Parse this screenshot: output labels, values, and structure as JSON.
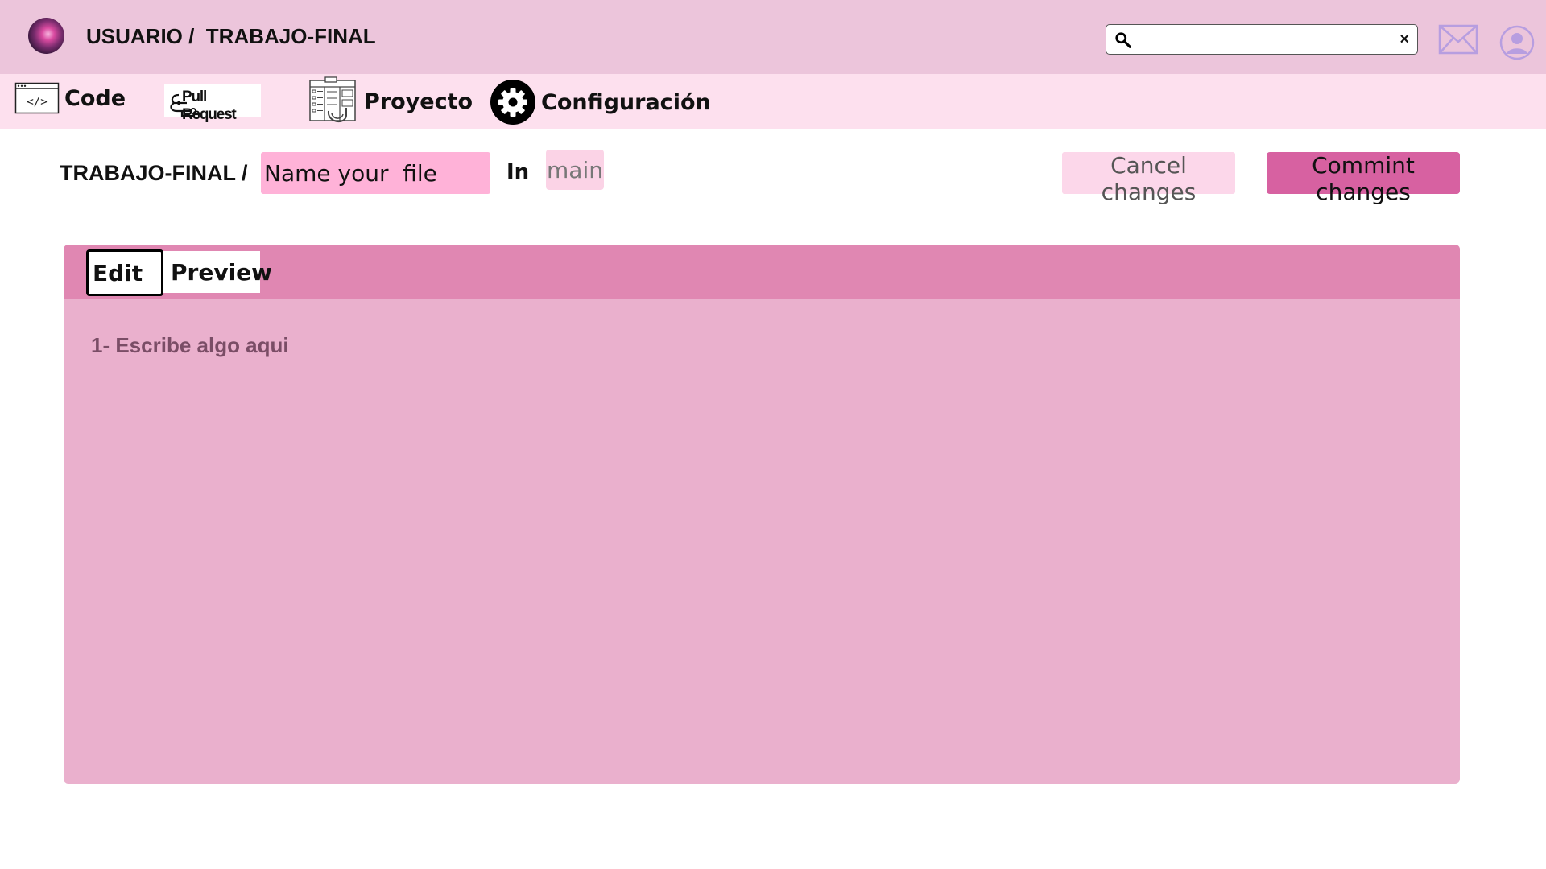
{
  "header": {
    "breadcrumb": "USUARIO /  TRABAJO-FINAL",
    "search": {
      "value": "",
      "clear_label": "×"
    },
    "icons": {
      "logo": "galaxy-avatar",
      "search": "search-icon",
      "mail": "mail-icon",
      "profile": "user-icon"
    }
  },
  "nav": {
    "code_label": "Code",
    "pull_request_label": "Pull Request",
    "project_label": "Proyecto",
    "settings_label": "Configuración"
  },
  "file_bar": {
    "repo_crumb": "TRABAJO-FINAL /",
    "filename_placeholder": "Name your  file",
    "in_label": "In",
    "branch": "main",
    "cancel_label": "Cancel changes",
    "commit_label": "Commint changes"
  },
  "editor": {
    "tabs": [
      {
        "label": "Edit",
        "active": true
      },
      {
        "label": "Preview",
        "active": false
      }
    ],
    "placeholder": "1- Escribe algo aqui"
  },
  "colors": {
    "topbar": "#ecc5db",
    "navbar": "#fde0ee",
    "filename_bg": "#ffb2d8",
    "commit_bg": "#d761a1",
    "editor_header": "#e087b2",
    "editor_body": "#eab0cd"
  }
}
